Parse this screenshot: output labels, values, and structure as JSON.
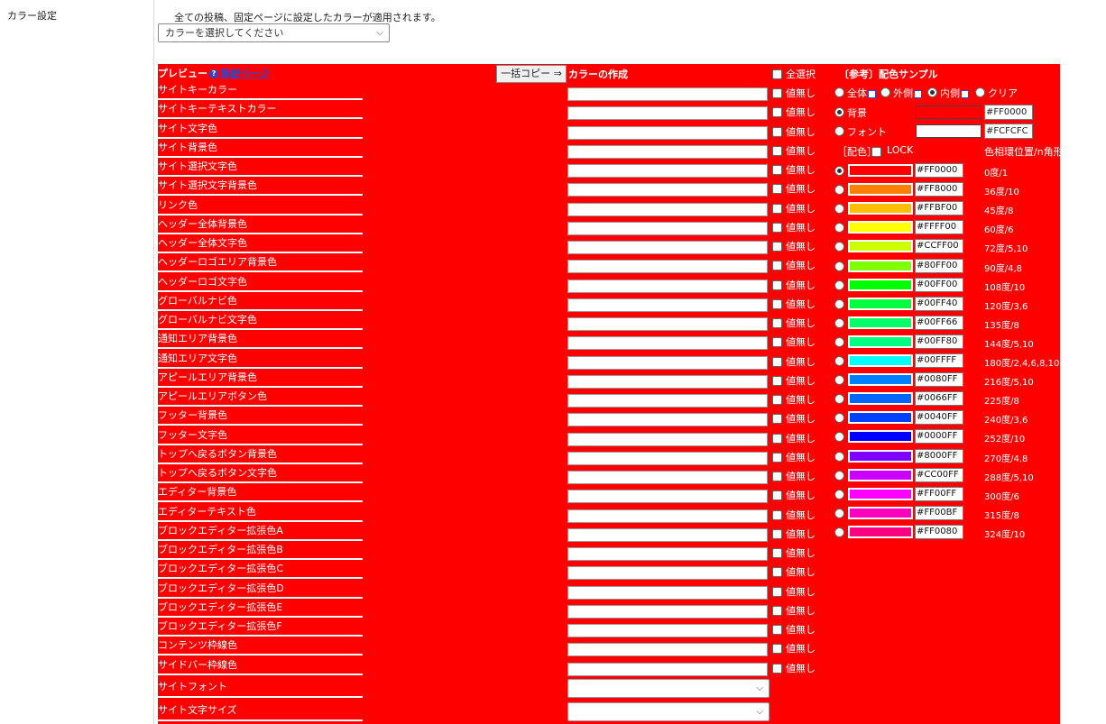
{
  "section_label": "カラー設定",
  "notice": "全ての投稿、固定ページに設定したカラーが適用されます。",
  "preset_select": "カラーを選択してください",
  "preview": {
    "title": "プレビュー",
    "link": "解説ページ"
  },
  "copy_button": "一括コピー ⇒",
  "create_title": "カラーの作成",
  "select_all": "全選択",
  "no_value": "値無し",
  "sample_title": "〔参考〕配色サンプル",
  "scope_options": [
    "全体",
    "外側",
    "内側",
    "クリア"
  ],
  "bg_label": "背景",
  "font_label": "フォント",
  "bg_hex": "#FF0000",
  "font_hex": "#FCFCFC",
  "bg_color": "#ff0000",
  "font_color": "#fcfcfc",
  "palette_label": "［配色］",
  "lock_label": "LOCK",
  "hue_header": "色相環位置/n角形",
  "settings": [
    "サイトキーカラー",
    "サイトキーテキストカラー",
    "サイト文字色",
    "サイト背景色",
    "サイト選択文字色",
    "サイト選択文字背景色",
    "リンク色",
    "ヘッダー全体背景色",
    "ヘッダー全体文字色",
    "ヘッダーロゴエリア背景色",
    "ヘッダーロゴ文字色",
    "グローバルナビ色",
    "グローバルナビ文字色",
    "通知エリア背景色",
    "通知エリア文字色",
    "アピールエリア背景色",
    "アピールエリアボタン色",
    "フッター背景色",
    "フッター文字色",
    "トップへ戻るボタン背景色",
    "トップへ戻るボタン文字色",
    "エディター背景色",
    "エディターテキスト色",
    "ブロックエディター拡張色A",
    "ブロックエディター拡張色B",
    "ブロックエディター拡張色C",
    "ブロックエディター拡張色D",
    "ブロックエディター拡張色E",
    "ブロックエディター拡張色F",
    "コンテンツ枠線色",
    "サイドバー枠線色"
  ],
  "select_settings": [
    "サイトフォント",
    "サイト文字サイズ"
  ],
  "palette": [
    {
      "hex": "#FF0000",
      "deg": "0度/1",
      "color": "#ff0000"
    },
    {
      "hex": "#FF8000",
      "deg": "36度/10",
      "color": "#ff8000"
    },
    {
      "hex": "#FFBF00",
      "deg": "45度/8",
      "color": "#ffbf00"
    },
    {
      "hex": "#FFFF00",
      "deg": "60度/6",
      "color": "#ffff00"
    },
    {
      "hex": "#CCFF00",
      "deg": "72度/5,10",
      "color": "#ccff00"
    },
    {
      "hex": "#80FF00",
      "deg": "90度/4,8",
      "color": "#80ff00"
    },
    {
      "hex": "#00FF00",
      "deg": "108度/10",
      "color": "#00ff00"
    },
    {
      "hex": "#00FF40",
      "deg": "120度/3,6",
      "color": "#00ff40"
    },
    {
      "hex": "#00FF66",
      "deg": "135度/8",
      "color": "#00ff66"
    },
    {
      "hex": "#00FF80",
      "deg": "144度/5,10",
      "color": "#00ff80"
    },
    {
      "hex": "#00FFFF",
      "deg": "180度/2,4,6,8,10",
      "color": "#00ffff"
    },
    {
      "hex": "#0080FF",
      "deg": "216度/5,10",
      "color": "#0080ff"
    },
    {
      "hex": "#0066FF",
      "deg": "225度/8",
      "color": "#0066ff"
    },
    {
      "hex": "#0040FF",
      "deg": "240度/3,6",
      "color": "#0040ff"
    },
    {
      "hex": "#0000FF",
      "deg": "252度/10",
      "color": "#0000ff"
    },
    {
      "hex": "#8000FF",
      "deg": "270度/4,8",
      "color": "#8000ff"
    },
    {
      "hex": "#CC00FF",
      "deg": "288度/5,10",
      "color": "#cc00ff"
    },
    {
      "hex": "#FF00FF",
      "deg": "300度/6",
      "color": "#ff00ff"
    },
    {
      "hex": "#FF00BF",
      "deg": "315度/8",
      "color": "#ff00bf"
    },
    {
      "hex": "#FF0080",
      "deg": "324度/10",
      "color": "#ff0080"
    }
  ],
  "colors": {
    "panel_bg": "#ff0000"
  }
}
